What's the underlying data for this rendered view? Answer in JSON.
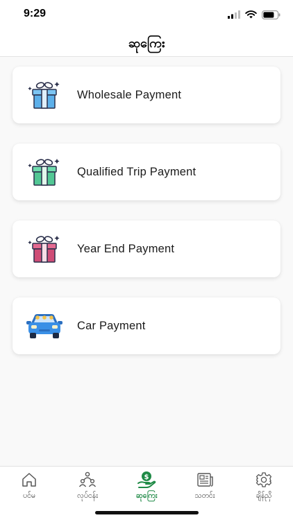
{
  "status_bar": {
    "time": "9:29"
  },
  "header": {
    "title": "ဆုကြေး"
  },
  "payments": [
    {
      "label": "Wholesale Payment",
      "icon": "gift-icon",
      "color": "#7cc4f2"
    },
    {
      "label": "Qualified Trip Payment",
      "icon": "gift-icon",
      "color": "#5fd1a0"
    },
    {
      "label": "Year End Payment",
      "icon": "gift-icon",
      "color": "#d9547e"
    },
    {
      "label": "Car Payment",
      "icon": "car-icon",
      "color": "#3a8fe6"
    }
  ],
  "tabs": [
    {
      "label": "ပင်မ",
      "icon": "home-icon"
    },
    {
      "label": "လုပ်ငန်း",
      "icon": "network-icon"
    },
    {
      "label": "ဆုကြေး",
      "icon": "reward-icon",
      "active": true
    },
    {
      "label": "သတင်း",
      "icon": "news-icon"
    },
    {
      "label": "ချိန်ညှိ",
      "icon": "settings-icon"
    }
  ],
  "colors": {
    "active_tab": "#1f8a46",
    "background": "#f9f9f9"
  }
}
